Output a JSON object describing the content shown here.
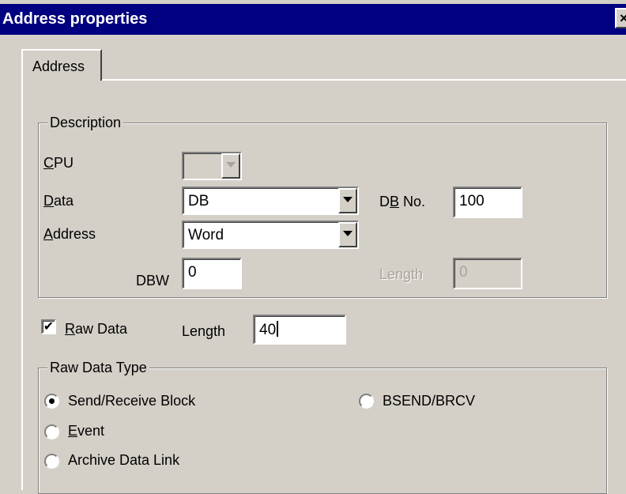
{
  "window": {
    "title": "Address properties",
    "close_glyph": "×"
  },
  "tabs": [
    {
      "label": "Address"
    }
  ],
  "description": {
    "legend": "Description",
    "cpu": {
      "label_access": "C",
      "label_rest": "PU",
      "value": ""
    },
    "data": {
      "label_access": "D",
      "label_rest": "ata",
      "value": "DB"
    },
    "db_no": {
      "label_pre": "D",
      "label_access": "B",
      "label_rest": " No.",
      "value": "100"
    },
    "address": {
      "label_access": "A",
      "label_rest": "ddress",
      "value": "Word"
    },
    "dbw": {
      "label": "DBW",
      "value": "0"
    },
    "length": {
      "label": "Length",
      "value": "0"
    }
  },
  "raw_data": {
    "checked": true,
    "check_glyph": "✔",
    "label_access": "R",
    "label_rest": "aw Data",
    "length_label": "Length",
    "length_value": "40"
  },
  "raw_data_type": {
    "legend": "Raw Data Type",
    "options": [
      {
        "label": "Send/Receive Block",
        "selected": true
      },
      {
        "label_access": "E",
        "label_rest": "vent",
        "selected": false
      },
      {
        "label": "Archive Data Link",
        "selected": false
      },
      {
        "label": "BSEND/BRCV",
        "selected": false
      }
    ]
  }
}
